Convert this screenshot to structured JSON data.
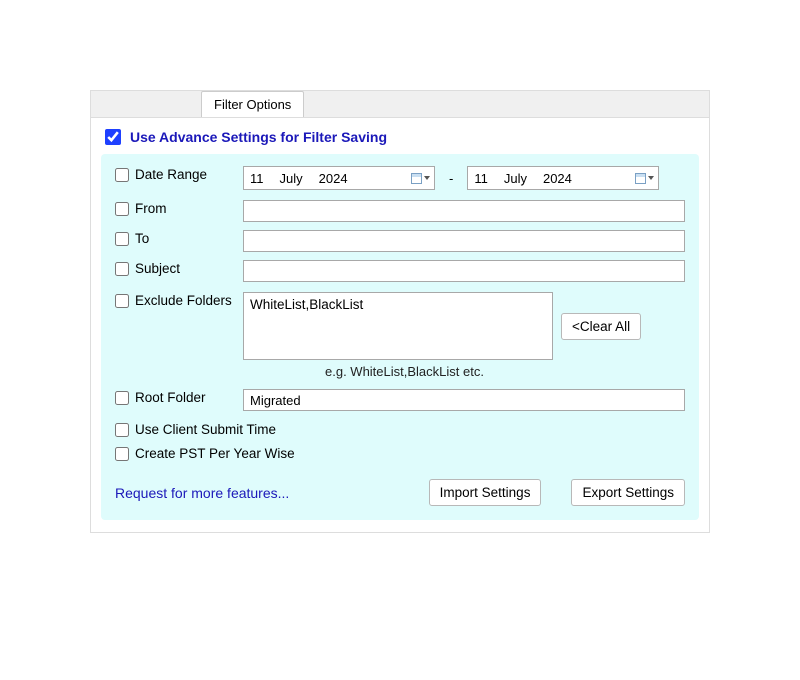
{
  "tab": {
    "label": "Filter Options"
  },
  "master": {
    "label": "Use Advance Settings for Filter Saving",
    "checked": true
  },
  "dateRange": {
    "label": "Date Range",
    "start": {
      "day": "11",
      "month": "July",
      "year": "2024"
    },
    "end": {
      "day": "11",
      "month": "July",
      "year": "2024"
    },
    "separator": "-"
  },
  "from": {
    "label": "From",
    "value": ""
  },
  "to": {
    "label": "To",
    "value": ""
  },
  "subject": {
    "label": "Subject",
    "value": ""
  },
  "exclude": {
    "label": "Exclude Folders",
    "value": "WhiteList,BlackList",
    "clear": "<Clear All",
    "hint": "e.g. WhiteList,BlackList etc."
  },
  "root": {
    "label": "Root Folder",
    "value": "Migrated"
  },
  "useClientSubmit": {
    "label": "Use Client Submit Time"
  },
  "createPstYear": {
    "label": "Create PST Per Year Wise"
  },
  "requestLink": "Request for more features...",
  "buttons": {
    "import": "Import Settings",
    "export": "Export Settings"
  }
}
